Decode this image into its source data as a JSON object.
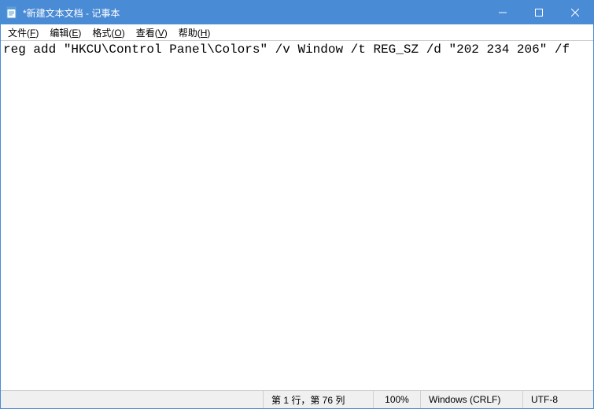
{
  "titlebar": {
    "title": "*新建文本文档 - 记事本"
  },
  "menubar": {
    "file": "文件(F)",
    "edit": "编辑(E)",
    "format": "格式(O)",
    "view": "查看(V)",
    "help": "帮助(H)"
  },
  "editor": {
    "content": "reg add \"HKCU\\Control Panel\\Colors\" /v Window /t REG_SZ /d \"202 234 206\" /f"
  },
  "statusbar": {
    "position": "第 1 行，第 76 列",
    "zoom": "100%",
    "line_ending": "Windows (CRLF)",
    "encoding": "UTF-8"
  }
}
